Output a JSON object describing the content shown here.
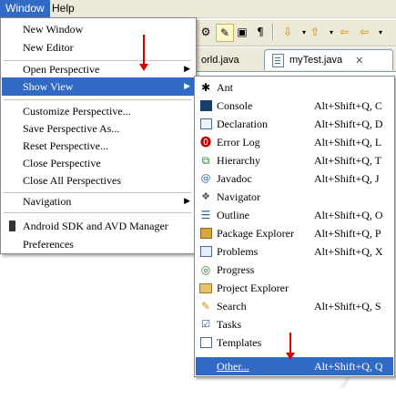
{
  "menubar": {
    "window": "Window",
    "help": "Help"
  },
  "editor": {
    "tabs": [
      {
        "label": "orld.java"
      },
      {
        "label": "myTest.java"
      }
    ],
    "watermark": "佑 天"
  },
  "window_menu": {
    "new_window": "New Window",
    "new_editor": "New Editor",
    "open_perspective": "Open Perspective",
    "show_view": "Show View",
    "customize_perspective": "Customize Perspective...",
    "save_perspective_as": "Save Perspective As...",
    "reset_perspective": "Reset Perspective...",
    "close_perspective": "Close Perspective",
    "close_all_perspectives": "Close All Perspectives",
    "navigation": "Navigation",
    "android_sdk": "Android SDK and AVD Manager",
    "preferences": "Preferences"
  },
  "show_view_menu": {
    "items": [
      {
        "label": "Ant",
        "shortcut": "",
        "icon": "ant-icon"
      },
      {
        "label": "Console",
        "shortcut": "Alt+Shift+Q, C",
        "icon": "console-icon"
      },
      {
        "label": "Declaration",
        "shortcut": "Alt+Shift+Q, D",
        "icon": "declaration-icon"
      },
      {
        "label": "Error Log",
        "shortcut": "Alt+Shift+Q, L",
        "icon": "error-log-icon"
      },
      {
        "label": "Hierarchy",
        "shortcut": "Alt+Shift+Q, T",
        "icon": "hierarchy-icon"
      },
      {
        "label": "Javadoc",
        "shortcut": "Alt+Shift+Q, J",
        "icon": "javadoc-icon"
      },
      {
        "label": "Navigator",
        "shortcut": "",
        "icon": "navigator-icon"
      },
      {
        "label": "Outline",
        "shortcut": "Alt+Shift+Q, O",
        "icon": "outline-icon"
      },
      {
        "label": "Package Explorer",
        "shortcut": "Alt+Shift+Q, P",
        "icon": "package-explorer-icon"
      },
      {
        "label": "Problems",
        "shortcut": "Alt+Shift+Q, X",
        "icon": "problems-icon"
      },
      {
        "label": "Progress",
        "shortcut": "",
        "icon": "progress-icon"
      },
      {
        "label": "Project Explorer",
        "shortcut": "",
        "icon": "project-explorer-icon"
      },
      {
        "label": "Search",
        "shortcut": "Alt+Shift+Q, S",
        "icon": "search-icon"
      },
      {
        "label": "Tasks",
        "shortcut": "",
        "icon": "tasks-icon"
      },
      {
        "label": "Templates",
        "shortcut": "",
        "icon": "templates-icon"
      },
      {
        "label": "Other...",
        "shortcut": "Alt+Shift+Q, Q",
        "icon": ""
      }
    ]
  },
  "colors": {
    "menu_highlight": "#316ac5",
    "menubar_bg": "#ece9d8",
    "annotation_arrow": "#d40000"
  }
}
